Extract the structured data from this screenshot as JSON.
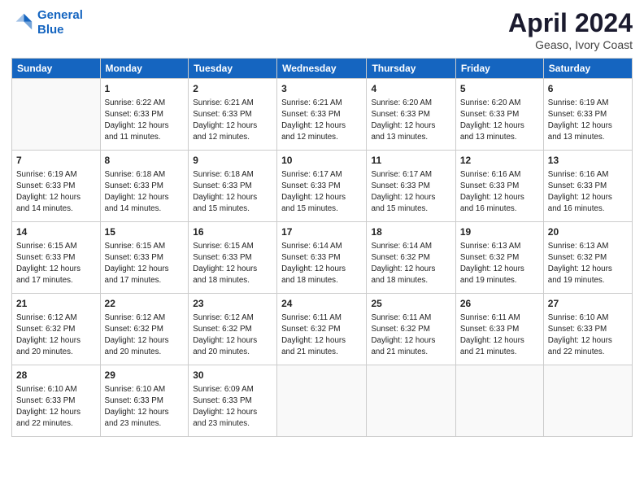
{
  "header": {
    "logo_line1": "General",
    "logo_line2": "Blue",
    "month_title": "April 2024",
    "location": "Geaso, Ivory Coast"
  },
  "weekdays": [
    "Sunday",
    "Monday",
    "Tuesday",
    "Wednesday",
    "Thursday",
    "Friday",
    "Saturday"
  ],
  "weeks": [
    [
      {
        "day": "",
        "info": ""
      },
      {
        "day": "1",
        "info": "Sunrise: 6:22 AM\nSunset: 6:33 PM\nDaylight: 12 hours\nand 11 minutes."
      },
      {
        "day": "2",
        "info": "Sunrise: 6:21 AM\nSunset: 6:33 PM\nDaylight: 12 hours\nand 12 minutes."
      },
      {
        "day": "3",
        "info": "Sunrise: 6:21 AM\nSunset: 6:33 PM\nDaylight: 12 hours\nand 12 minutes."
      },
      {
        "day": "4",
        "info": "Sunrise: 6:20 AM\nSunset: 6:33 PM\nDaylight: 12 hours\nand 13 minutes."
      },
      {
        "day": "5",
        "info": "Sunrise: 6:20 AM\nSunset: 6:33 PM\nDaylight: 12 hours\nand 13 minutes."
      },
      {
        "day": "6",
        "info": "Sunrise: 6:19 AM\nSunset: 6:33 PM\nDaylight: 12 hours\nand 13 minutes."
      }
    ],
    [
      {
        "day": "7",
        "info": "Sunrise: 6:19 AM\nSunset: 6:33 PM\nDaylight: 12 hours\nand 14 minutes."
      },
      {
        "day": "8",
        "info": "Sunrise: 6:18 AM\nSunset: 6:33 PM\nDaylight: 12 hours\nand 14 minutes."
      },
      {
        "day": "9",
        "info": "Sunrise: 6:18 AM\nSunset: 6:33 PM\nDaylight: 12 hours\nand 15 minutes."
      },
      {
        "day": "10",
        "info": "Sunrise: 6:17 AM\nSunset: 6:33 PM\nDaylight: 12 hours\nand 15 minutes."
      },
      {
        "day": "11",
        "info": "Sunrise: 6:17 AM\nSunset: 6:33 PM\nDaylight: 12 hours\nand 15 minutes."
      },
      {
        "day": "12",
        "info": "Sunrise: 6:16 AM\nSunset: 6:33 PM\nDaylight: 12 hours\nand 16 minutes."
      },
      {
        "day": "13",
        "info": "Sunrise: 6:16 AM\nSunset: 6:33 PM\nDaylight: 12 hours\nand 16 minutes."
      }
    ],
    [
      {
        "day": "14",
        "info": "Sunrise: 6:15 AM\nSunset: 6:33 PM\nDaylight: 12 hours\nand 17 minutes."
      },
      {
        "day": "15",
        "info": "Sunrise: 6:15 AM\nSunset: 6:33 PM\nDaylight: 12 hours\nand 17 minutes."
      },
      {
        "day": "16",
        "info": "Sunrise: 6:15 AM\nSunset: 6:33 PM\nDaylight: 12 hours\nand 18 minutes."
      },
      {
        "day": "17",
        "info": "Sunrise: 6:14 AM\nSunset: 6:33 PM\nDaylight: 12 hours\nand 18 minutes."
      },
      {
        "day": "18",
        "info": "Sunrise: 6:14 AM\nSunset: 6:32 PM\nDaylight: 12 hours\nand 18 minutes."
      },
      {
        "day": "19",
        "info": "Sunrise: 6:13 AM\nSunset: 6:32 PM\nDaylight: 12 hours\nand 19 minutes."
      },
      {
        "day": "20",
        "info": "Sunrise: 6:13 AM\nSunset: 6:32 PM\nDaylight: 12 hours\nand 19 minutes."
      }
    ],
    [
      {
        "day": "21",
        "info": "Sunrise: 6:12 AM\nSunset: 6:32 PM\nDaylight: 12 hours\nand 20 minutes."
      },
      {
        "day": "22",
        "info": "Sunrise: 6:12 AM\nSunset: 6:32 PM\nDaylight: 12 hours\nand 20 minutes."
      },
      {
        "day": "23",
        "info": "Sunrise: 6:12 AM\nSunset: 6:32 PM\nDaylight: 12 hours\nand 20 minutes."
      },
      {
        "day": "24",
        "info": "Sunrise: 6:11 AM\nSunset: 6:32 PM\nDaylight: 12 hours\nand 21 minutes."
      },
      {
        "day": "25",
        "info": "Sunrise: 6:11 AM\nSunset: 6:32 PM\nDaylight: 12 hours\nand 21 minutes."
      },
      {
        "day": "26",
        "info": "Sunrise: 6:11 AM\nSunset: 6:33 PM\nDaylight: 12 hours\nand 21 minutes."
      },
      {
        "day": "27",
        "info": "Sunrise: 6:10 AM\nSunset: 6:33 PM\nDaylight: 12 hours\nand 22 minutes."
      }
    ],
    [
      {
        "day": "28",
        "info": "Sunrise: 6:10 AM\nSunset: 6:33 PM\nDaylight: 12 hours\nand 22 minutes."
      },
      {
        "day": "29",
        "info": "Sunrise: 6:10 AM\nSunset: 6:33 PM\nDaylight: 12 hours\nand 23 minutes."
      },
      {
        "day": "30",
        "info": "Sunrise: 6:09 AM\nSunset: 6:33 PM\nDaylight: 12 hours\nand 23 minutes."
      },
      {
        "day": "",
        "info": ""
      },
      {
        "day": "",
        "info": ""
      },
      {
        "day": "",
        "info": ""
      },
      {
        "day": "",
        "info": ""
      }
    ]
  ]
}
